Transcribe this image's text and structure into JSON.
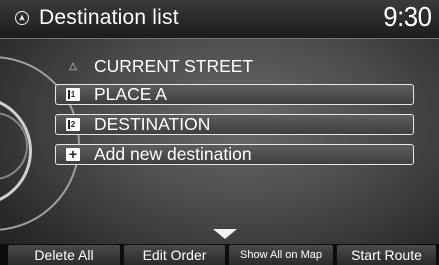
{
  "header": {
    "title": "Destination list",
    "clock": "9:30",
    "nav_icon": "navigation-icon"
  },
  "list": {
    "items": [
      {
        "label": "CURRENT STREET",
        "icon": "triangle-icon",
        "icon_text": "△",
        "style": "plain"
      },
      {
        "label": "PLACE A",
        "icon": "waypoint-1-icon",
        "icon_text": "1",
        "style": "boxed"
      },
      {
        "label": "DESTINATION",
        "icon": "waypoint-2-icon",
        "icon_text": "2",
        "style": "boxed"
      },
      {
        "label": "Add new destination",
        "icon": "plus-icon",
        "icon_text": "+",
        "style": "boxed"
      }
    ],
    "scroll_indicator": "chevron-down-icon"
  },
  "softkeys": {
    "delete_all": "Delete All",
    "edit_order": "Edit Order",
    "show_all_on_map": "Show All on Map",
    "start_route": "Start Route"
  }
}
